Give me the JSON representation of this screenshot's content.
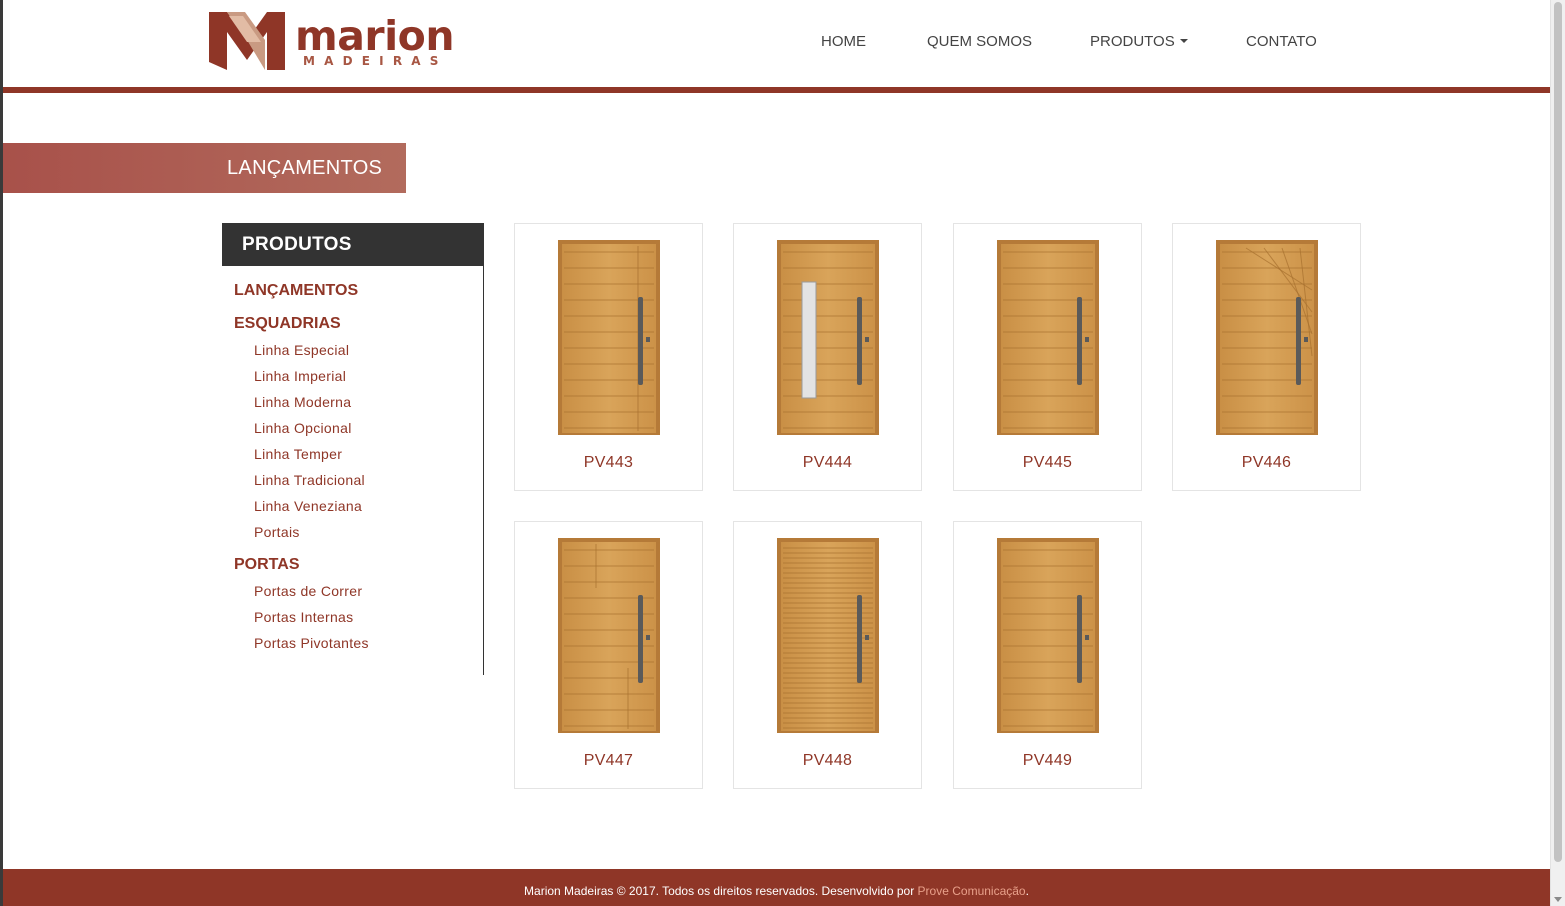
{
  "brand": {
    "name": "marion",
    "tagline": "MADEIRAS"
  },
  "nav": {
    "items": [
      {
        "label": "HOME"
      },
      {
        "label": "QUEM SOMOS"
      },
      {
        "label": "PRODUTOS"
      },
      {
        "label": "CONTATO"
      }
    ]
  },
  "page": {
    "title": "LANÇAMENTOS"
  },
  "sidebar": {
    "heading": "PRODUTOS",
    "categories": [
      {
        "label": "LANÇAMENTOS",
        "items": []
      },
      {
        "label": "ESQUADRIAS",
        "items": [
          "Linha Especial",
          "Linha Imperial",
          "Linha Moderna",
          "Linha Opcional",
          "Linha Temper",
          "Linha Tradicional",
          "Linha Veneziana",
          "Portais"
        ]
      },
      {
        "label": "PORTAS",
        "items": [
          "Portas de Correr",
          "Portas Internas",
          "Portas Pivotantes"
        ]
      }
    ]
  },
  "products": [
    {
      "code": "PV443",
      "style": "offset-stile"
    },
    {
      "code": "PV444",
      "style": "glass-strip"
    },
    {
      "code": "PV445",
      "style": "horizontal"
    },
    {
      "code": "PV446",
      "style": "diagonal"
    },
    {
      "code": "PV447",
      "style": "mixed-blocks"
    },
    {
      "code": "PV448",
      "style": "fine-slats"
    },
    {
      "code": "PV449",
      "style": "horizontal"
    }
  ],
  "footer": {
    "text": "Marion Madeiras © 2017. Todos os direitos reservados. Desenvolvido por ",
    "link": "Prove Comunicação",
    "end": "."
  },
  "colors": {
    "brand": "#8f3627",
    "banner": "#a8514a",
    "sidebar_head": "#333333",
    "wood": "#d9a45a",
    "handle": "#5a5a5a"
  }
}
